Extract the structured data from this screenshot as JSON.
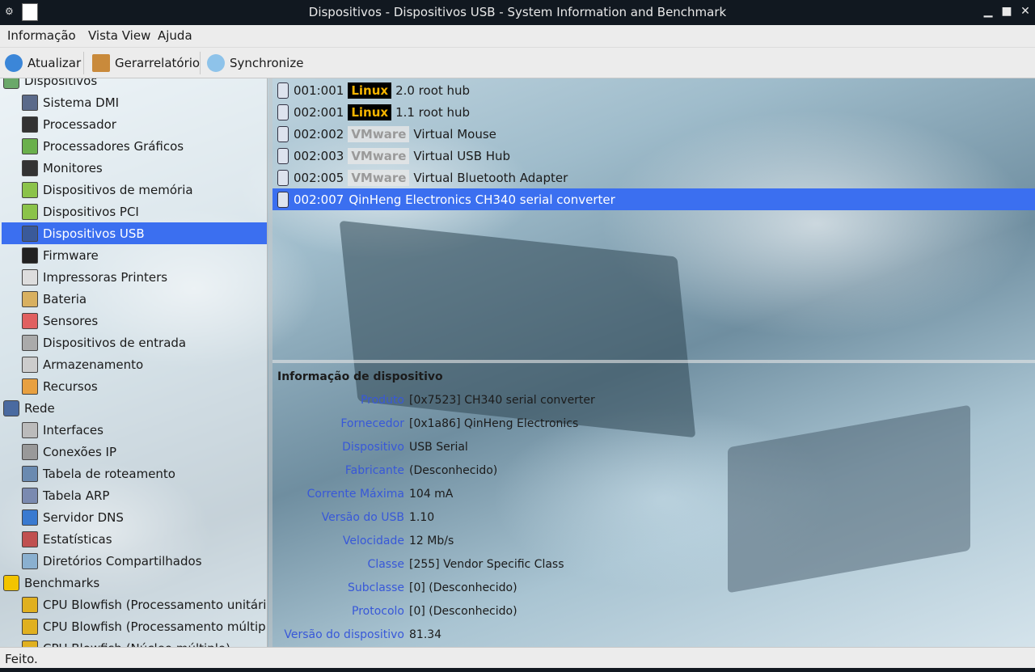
{
  "window": {
    "title": "Dispositivos  - Dispositivos USB  - System Information and Benchmark",
    "minimize": "▁",
    "maximize": "■",
    "close": "✕",
    "menu_glyph": "⚙"
  },
  "menubar": [
    "Informação",
    "Vista View",
    "Ajuda"
  ],
  "toolbar": [
    {
      "label": "Atualizar",
      "icon": "refresh-icon"
    },
    {
      "label": "Gerarrelatório",
      "icon": "report-icon"
    },
    {
      "label": "Synchronize",
      "icon": "cloud-sync-icon"
    }
  ],
  "sidebar": {
    "items": [
      {
        "label": "Dispositivos",
        "level": 0,
        "icon": "devices-icon"
      },
      {
        "label": "Sistema DMI",
        "level": 1,
        "icon": "computer-icon"
      },
      {
        "label": "Processador",
        "level": 1,
        "icon": "cpu-icon"
      },
      {
        "label": "Processadores Gráficos",
        "level": 1,
        "icon": "gpu-icon"
      },
      {
        "label": "Monitores",
        "level": 1,
        "icon": "monitor-icon"
      },
      {
        "label": "Dispositivos de memória",
        "level": 1,
        "icon": "memory-icon"
      },
      {
        "label": "Dispositivos PCI",
        "level": 1,
        "icon": "pci-icon"
      },
      {
        "label": "Dispositivos USB",
        "level": 1,
        "icon": "usb-icon",
        "selected": true
      },
      {
        "label": "Firmware",
        "level": 1,
        "icon": "firmware-icon"
      },
      {
        "label": "Impressoras Printers",
        "level": 1,
        "icon": "printer-icon"
      },
      {
        "label": "Bateria",
        "level": 1,
        "icon": "battery-icon"
      },
      {
        "label": "Sensores",
        "level": 1,
        "icon": "thermometer-icon"
      },
      {
        "label": "Dispositivos de entrada",
        "level": 1,
        "icon": "input-device-icon"
      },
      {
        "label": "Armazenamento",
        "level": 1,
        "icon": "storage-icon"
      },
      {
        "label": "Recursos",
        "level": 1,
        "icon": "resources-icon"
      },
      {
        "label": "Rede",
        "level": 0,
        "icon": "network-icon"
      },
      {
        "label": "Interfaces",
        "level": 1,
        "icon": "interface-icon"
      },
      {
        "label": "Conexões IP",
        "level": 1,
        "icon": "plug-icon"
      },
      {
        "label": "Tabela de roteamento",
        "level": 1,
        "icon": "routing-icon"
      },
      {
        "label": "Tabela ARP",
        "level": 1,
        "icon": "arp-icon"
      },
      {
        "label": "Servidor DNS",
        "level": 1,
        "icon": "dns-icon"
      },
      {
        "label": "Estatísticas",
        "level": 1,
        "icon": "statistics-icon"
      },
      {
        "label": "Diretórios Compartilhados",
        "level": 1,
        "icon": "shared-folder-icon"
      },
      {
        "label": "Benchmarks",
        "level": 0,
        "icon": "benchmark-icon"
      },
      {
        "label": "CPU Blowfish (Processamento unitário)",
        "level": 1,
        "icon": "blowfish-icon"
      },
      {
        "label": "CPU Blowfish (Processamento múltiplo)",
        "level": 1,
        "icon": "blowfish-icon"
      },
      {
        "label": "CPU Blowfish (Núcleo múltiplo)",
        "level": 1,
        "icon": "blowfish-icon"
      }
    ]
  },
  "usb_devices": [
    {
      "id": "001:001",
      "vendor": "Linux",
      "vendor_style": "linux",
      "name": "2.0 root hub",
      "icon": "usb-icon"
    },
    {
      "id": "002:001",
      "vendor": "Linux",
      "vendor_style": "linux",
      "name": "1.1 root hub",
      "icon": "usb-icon"
    },
    {
      "id": "002:002",
      "vendor": "VMware",
      "vendor_style": "vm",
      "name": "Virtual Mouse",
      "icon": "mouse-icon"
    },
    {
      "id": "002:003",
      "vendor": "VMware",
      "vendor_style": "vm",
      "name": "Virtual USB Hub",
      "icon": "usb-icon"
    },
    {
      "id": "002:005",
      "vendor": "VMware",
      "vendor_style": "vm",
      "name": "Virtual Bluetooth Adapter",
      "icon": "bluetooth-icon"
    },
    {
      "id": "002:007",
      "vendor": "",
      "vendor_style": "none",
      "name": "QinHeng Electronics CH340 serial converter",
      "icon": "usb-icon",
      "selected": true
    }
  ],
  "device_info": {
    "header": "Informação de dispositivo",
    "rows": [
      {
        "key": "Produto",
        "value": "[0x7523] CH340 serial converter"
      },
      {
        "key": "Fornecedor",
        "value": "[0x1a86] QinHeng Electronics"
      },
      {
        "key": "Dispositivo",
        "value": "USB Serial"
      },
      {
        "key": "Fabricante",
        "value": "(Desconhecido)"
      },
      {
        "key": "Corrente Máxima",
        "value": "104 mA"
      },
      {
        "key": "Versão do USB",
        "value": "1.10"
      },
      {
        "key": "Velocidade",
        "value": "12 Mb/s"
      },
      {
        "key": "Classe",
        "value": "[255] Vendor Specific Class"
      },
      {
        "key": "Subclasse",
        "value": "[0] (Desconhecido)"
      },
      {
        "key": "Protocolo",
        "value": "[0] (Desconhecido)"
      },
      {
        "key": "Versão do dispositivo",
        "value": "81.34"
      }
    ]
  },
  "status": "Feito.",
  "colors": {
    "selection": "#3b6ff0",
    "link_key": "#3858d8",
    "linux_badge_text": "#f5b400"
  }
}
